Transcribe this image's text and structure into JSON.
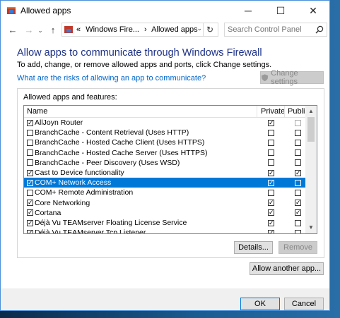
{
  "window": {
    "title": "Allowed apps"
  },
  "titlebar": {
    "minimize_glyph": "─",
    "maximize_glyph": "☐",
    "close_glyph": "✕"
  },
  "nav": {
    "back_glyph": "←",
    "forward_glyph": "→",
    "up_glyph": "↑"
  },
  "address": {
    "prefix": "«",
    "crumb1": "Windows Fire...",
    "sep": "›",
    "crumb2": "Allowed apps",
    "dropdown_glyph": "⌄",
    "refresh_glyph": "↻"
  },
  "search": {
    "placeholder": "Search Control Panel"
  },
  "content": {
    "heading": "Allow apps to communicate through Windows Firewall",
    "subtext": "To add, change, or remove allowed apps and ports, click Change settings.",
    "risk_link": "What are the risks of allowing an app to communicate?",
    "change_settings": "Change settings"
  },
  "group": {
    "label": "Allowed apps and features:"
  },
  "table": {
    "columns": [
      "Name",
      "Private",
      "Public"
    ],
    "rows": [
      {
        "name": "AllJoyn Router",
        "enabled": true,
        "private": true,
        "public": false,
        "public_disabled": true
      },
      {
        "name": "BranchCache - Content Retrieval (Uses HTTP)",
        "enabled": false,
        "private": false,
        "public": false
      },
      {
        "name": "BranchCache - Hosted Cache Client (Uses HTTPS)",
        "enabled": false,
        "private": false,
        "public": false
      },
      {
        "name": "BranchCache - Hosted Cache Server (Uses HTTPS)",
        "enabled": false,
        "private": false,
        "public": false
      },
      {
        "name": "BranchCache - Peer Discovery (Uses WSD)",
        "enabled": false,
        "private": false,
        "public": false
      },
      {
        "name": "Cast to Device functionality",
        "enabled": true,
        "private": true,
        "public": true
      },
      {
        "name": "COM+ Network Access",
        "enabled": true,
        "private": true,
        "public": false,
        "selected": true
      },
      {
        "name": "COM+ Remote Administration",
        "enabled": false,
        "private": false,
        "public": false
      },
      {
        "name": "Core Networking",
        "enabled": true,
        "private": true,
        "public": true
      },
      {
        "name": "Cortana",
        "enabled": true,
        "private": true,
        "public": true
      },
      {
        "name": "Déjà Vu TEAMserver Floating License Service",
        "enabled": true,
        "private": true,
        "public": false
      },
      {
        "name": "Déjà Vu TEAMserver Tcp Listener",
        "enabled": true,
        "private": true,
        "public": false
      }
    ]
  },
  "buttons": {
    "details": "Details...",
    "remove": "Remove",
    "allow_another": "Allow another app...",
    "ok": "OK",
    "cancel": "Cancel"
  },
  "colors": {
    "heading": "#1e3287",
    "link": "#0066cc",
    "selection": "#0078d7"
  }
}
